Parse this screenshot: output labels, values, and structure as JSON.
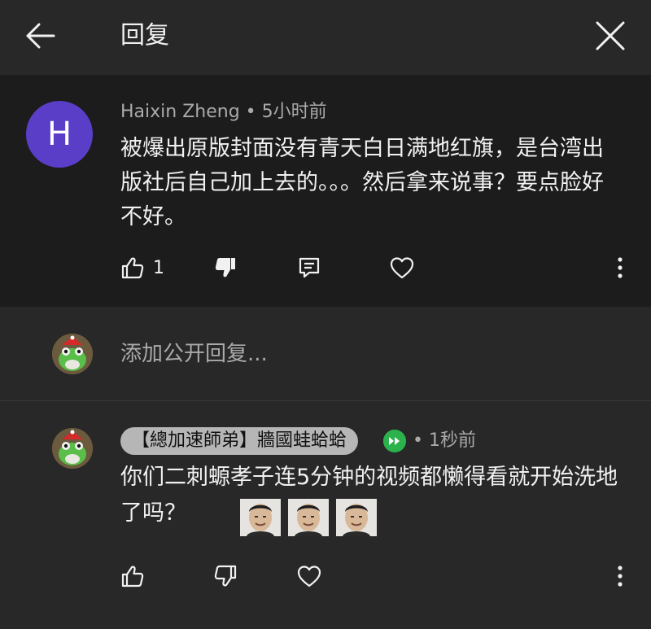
{
  "header": {
    "title": "回复"
  },
  "comment": {
    "avatar_letter": "H",
    "author": "Haixin Zheng",
    "separator": " • ",
    "time": "5小时前",
    "text": "被爆出原版封面没有青天白日满地红旗，是台湾出版社后自己加上去的。。。然后拿来说事？要点脸好不好。",
    "like_count": "1"
  },
  "reply_box": {
    "placeholder": "添加公开回复..."
  },
  "reply": {
    "author": "【總加速師弟】牆國蛙蛤蛤",
    "separator": " • ",
    "time": "1秒前",
    "text": "你们二刺螈孝子连5分钟的视频都懒得看就开始洗地了吗？",
    "emoji_count": 3
  },
  "colors": {
    "background": "#282828",
    "comment_background": "#1c1c1c",
    "avatar": "#5a3ec8",
    "member_badge": "#2bb24c"
  }
}
